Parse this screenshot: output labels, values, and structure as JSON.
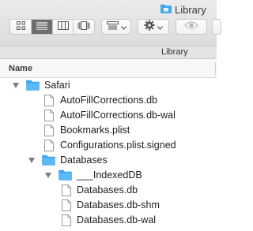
{
  "window": {
    "title": "Library",
    "title_icon": "folder-icon"
  },
  "toolbar": {
    "view_icon_mode": "icon-view-icon",
    "view_list_mode": "list-view-icon",
    "view_column_mode": "column-view-icon",
    "view_cover_flow_mode": "cover-flow-icon",
    "group_by": "group-icon",
    "action": "gear-icon",
    "share_preview": "eye-icon"
  },
  "path_bar": {
    "label": "Library"
  },
  "columns": {
    "name": "Name"
  },
  "rows": [
    {
      "label": "Safari",
      "type": "folder",
      "expanded": true
    },
    {
      "label": "AutoFillCorrections.db",
      "type": "file"
    },
    {
      "label": "AutoFillCorrections.db-wal",
      "type": "file"
    },
    {
      "label": "Bookmarks.plist",
      "type": "file"
    },
    {
      "label": "Configurations.plist.signed",
      "type": "file"
    },
    {
      "label": "Databases",
      "type": "folder",
      "expanded": true
    },
    {
      "label": "___IndexedDB",
      "type": "folder",
      "expanded": true
    },
    {
      "label": "Databases.db",
      "type": "file"
    },
    {
      "label": "Databases.db-shm",
      "type": "file"
    },
    {
      "label": "Databases.db-wal",
      "type": "file"
    }
  ],
  "colors": {
    "folder_blue": "#3fa9f5",
    "disclosure_gray": "#7c7c7c",
    "active_segment": "#6f6f6f"
  }
}
